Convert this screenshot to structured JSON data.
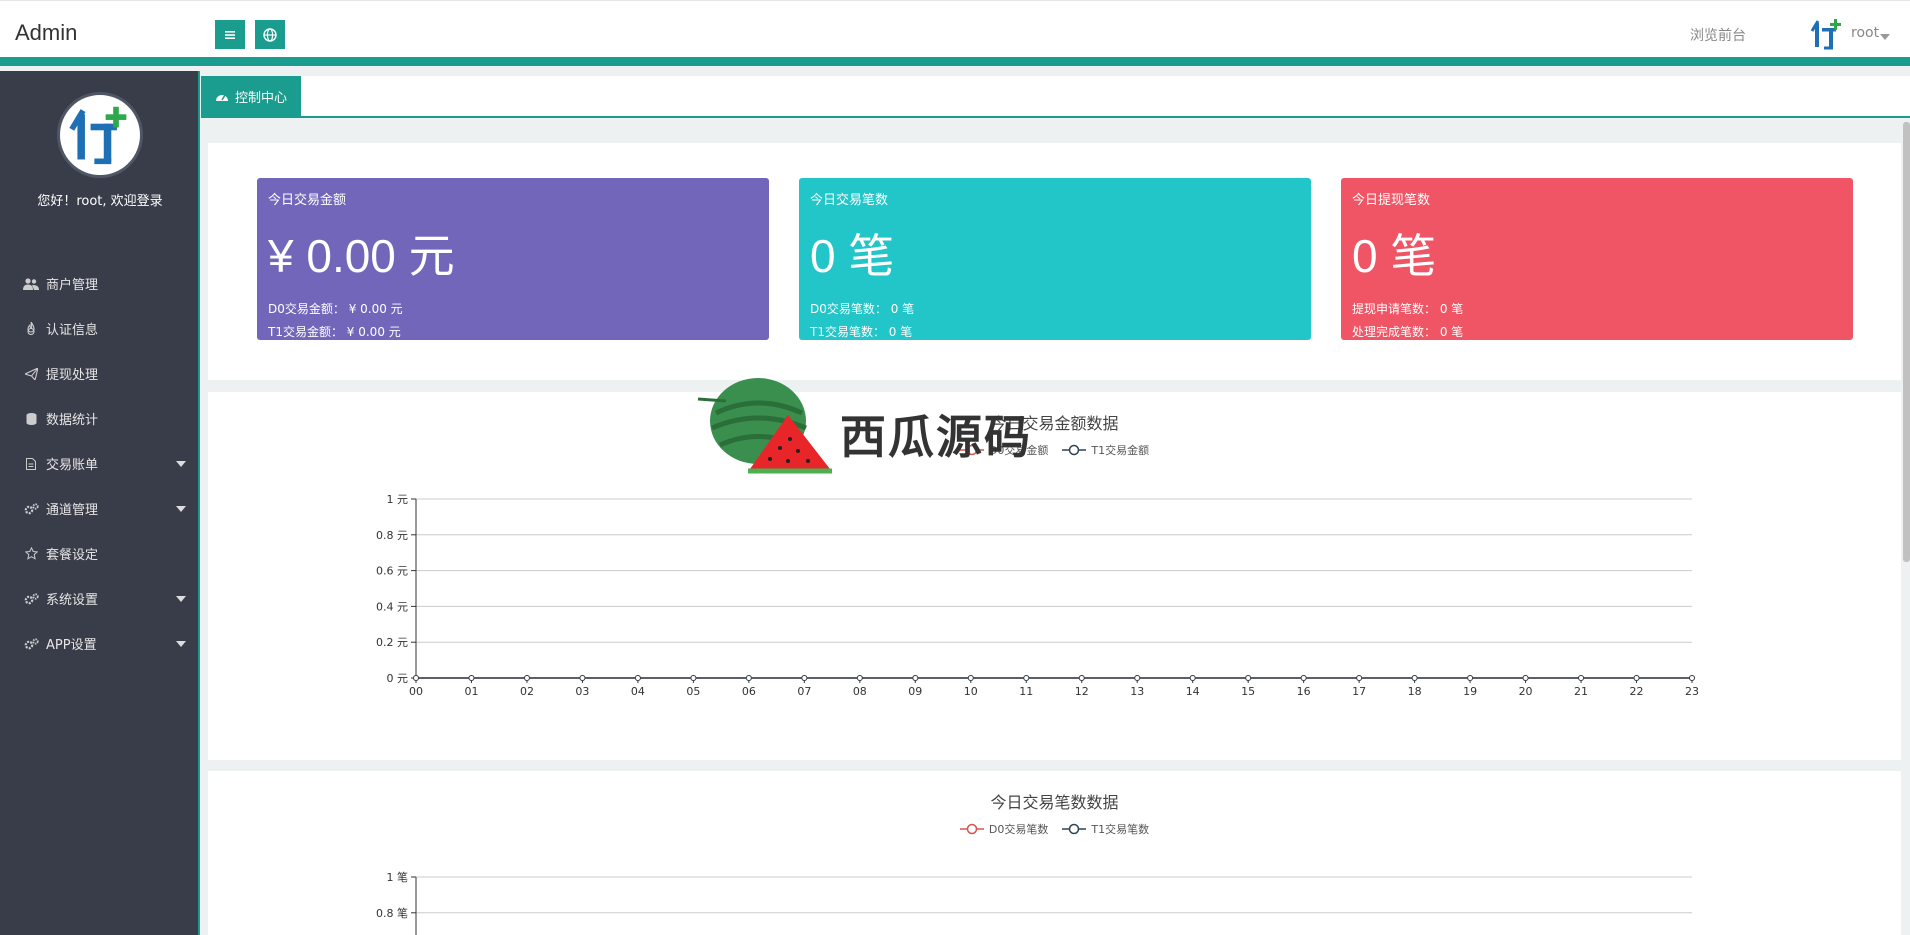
{
  "header": {
    "brand": "Admin",
    "front_link": "浏览前台",
    "user_name": "root"
  },
  "sidebar": {
    "welcome": "您好！root, 欢迎登录",
    "items": [
      {
        "label": "商户管理",
        "icon": "users-icon",
        "has_submenu": false
      },
      {
        "label": "认证信息",
        "icon": "fire-icon",
        "has_submenu": false
      },
      {
        "label": "提现处理",
        "icon": "send-icon",
        "has_submenu": false
      },
      {
        "label": "数据统计",
        "icon": "database-icon",
        "has_submenu": false
      },
      {
        "label": "交易账单",
        "icon": "file-icon",
        "has_submenu": true
      },
      {
        "label": "通道管理",
        "icon": "gears-icon",
        "has_submenu": true
      },
      {
        "label": "套餐设定",
        "icon": "star-icon",
        "has_submenu": false
      },
      {
        "label": "系统设置",
        "icon": "gears-icon",
        "has_submenu": true
      },
      {
        "label": "APP设置",
        "icon": "gears-icon",
        "has_submenu": true
      }
    ]
  },
  "tabs": {
    "active": "控制中心"
  },
  "stats": [
    {
      "title": "今日交易金额",
      "big": "¥ 0.00 元",
      "line1": "D0交易金额：  ¥ 0.00 元",
      "line2": "T1交易金额：  ¥ 0.00 元",
      "color": "#7266ba"
    },
    {
      "title": "今日交易笔数",
      "big": "0 笔",
      "line1": "D0交易笔数：  0 笔",
      "line2": "T1交易笔数：  0 笔",
      "color": "#23c6c8"
    },
    {
      "title": "今日提现笔数",
      "big": "0 笔",
      "line1": "提现申请笔数：  0 笔",
      "line2": "处理完成笔数：  0 笔",
      "color": "#ef5565"
    }
  ],
  "watermark": {
    "text": "西瓜源码"
  },
  "chart_data": [
    {
      "type": "line",
      "title": "今日交易金额数据",
      "x": [
        "00",
        "01",
        "02",
        "03",
        "04",
        "05",
        "06",
        "07",
        "08",
        "09",
        "10",
        "11",
        "12",
        "13",
        "14",
        "15",
        "16",
        "17",
        "18",
        "19",
        "20",
        "21",
        "22",
        "23"
      ],
      "series": [
        {
          "name": "D0交易金额",
          "color": "#d9534f",
          "values": [
            0,
            0,
            0,
            0,
            0,
            0,
            0,
            0,
            0,
            0,
            0,
            0,
            0,
            0,
            0,
            0,
            0,
            0,
            0,
            0,
            0,
            0,
            0,
            0
          ]
        },
        {
          "name": "T1交易金额",
          "color": "#2f4554",
          "values": [
            0,
            0,
            0,
            0,
            0,
            0,
            0,
            0,
            0,
            0,
            0,
            0,
            0,
            0,
            0,
            0,
            0,
            0,
            0,
            0,
            0,
            0,
            0,
            0
          ]
        }
      ],
      "ylim": [
        0,
        1
      ],
      "y_ticks": [
        "0 元",
        "0.2 元",
        "0.4 元",
        "0.6 元",
        "0.8 元",
        "1 元"
      ],
      "legend": "top-center",
      "grid": true
    },
    {
      "type": "line",
      "title": "今日交易笔数数据",
      "series": [
        {
          "name": "D0交易笔数",
          "color": "#d9534f"
        },
        {
          "name": "T1交易笔数",
          "color": "#2f4554"
        }
      ],
      "ylim": [
        0,
        1
      ],
      "y_ticks": [
        "0.8 笔",
        "1 笔"
      ],
      "legend": "top-center",
      "grid": true
    }
  ]
}
